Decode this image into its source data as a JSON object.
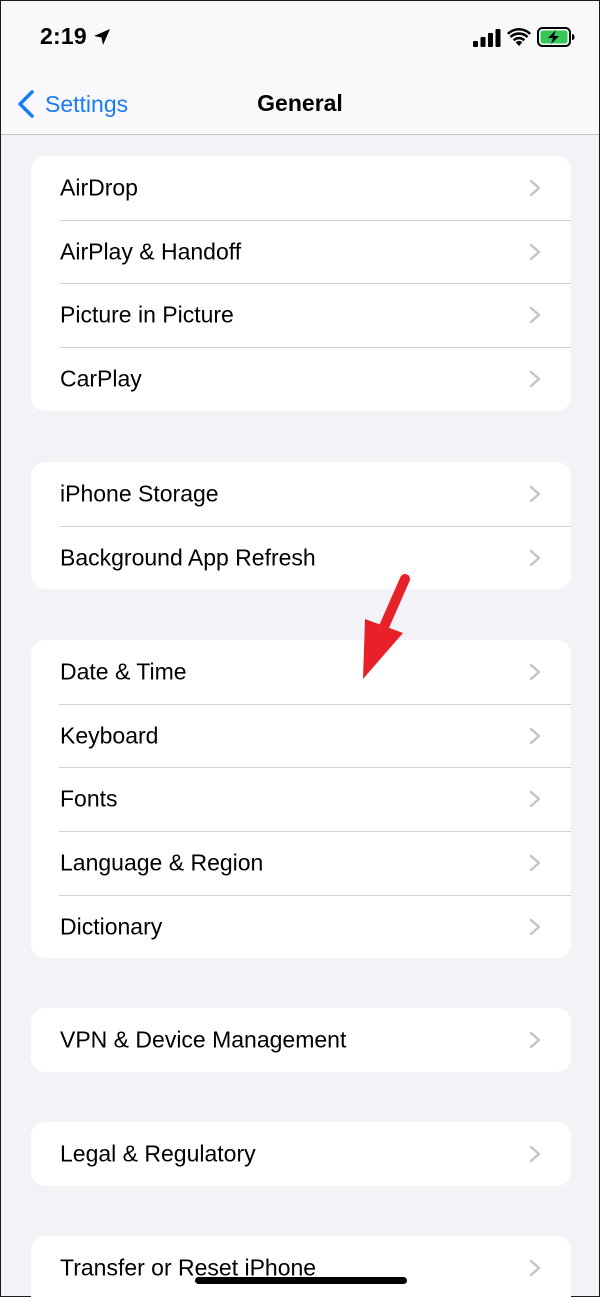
{
  "status_bar": {
    "time": "2:19"
  },
  "nav": {
    "back_label": "Settings",
    "title": "General"
  },
  "groups": [
    {
      "items": [
        {
          "label": "AirDrop"
        },
        {
          "label": "AirPlay & Handoff"
        },
        {
          "label": "Picture in Picture"
        },
        {
          "label": "CarPlay"
        }
      ]
    },
    {
      "items": [
        {
          "label": "iPhone Storage"
        },
        {
          "label": "Background App Refresh"
        }
      ]
    },
    {
      "items": [
        {
          "label": "Date & Time"
        },
        {
          "label": "Keyboard"
        },
        {
          "label": "Fonts"
        },
        {
          "label": "Language & Region"
        },
        {
          "label": "Dictionary"
        }
      ]
    },
    {
      "items": [
        {
          "label": "VPN & Device Management"
        }
      ]
    },
    {
      "items": [
        {
          "label": "Legal & Regulatory"
        }
      ]
    },
    {
      "items": [
        {
          "label": "Transfer or Reset iPhone"
        }
      ]
    }
  ],
  "colors": {
    "accent": "#1a7cf5",
    "background": "#f2f2f7",
    "annotation_arrow": "#e8202a",
    "battery": "#34c759"
  },
  "icons": {
    "location": "location-arrow-icon",
    "signal": "cellular-signal-icon",
    "wifi": "wifi-icon",
    "battery": "battery-charging-icon",
    "back": "chevron-left-icon",
    "row": "chevron-right-icon"
  }
}
